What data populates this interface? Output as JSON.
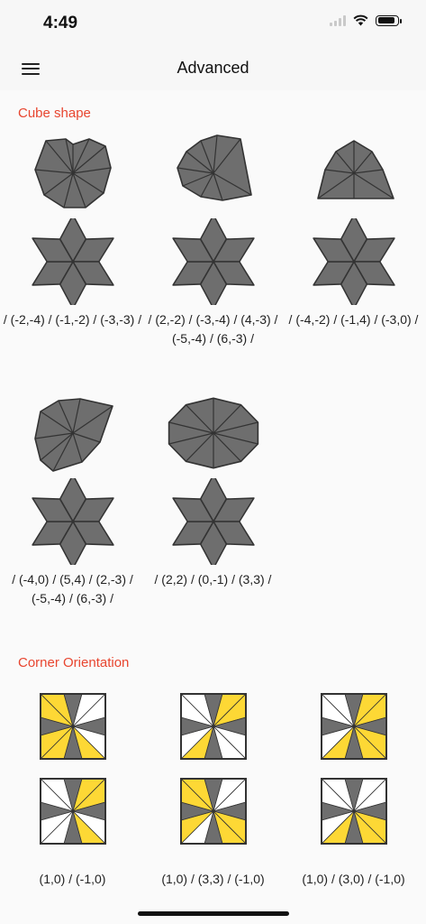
{
  "status": {
    "time": "4:49",
    "icons": [
      "signal-icon",
      "wifi-icon",
      "battery-icon"
    ]
  },
  "nav": {
    "title": "Advanced",
    "menu_icon": "hamburger-menu-icon"
  },
  "sections": {
    "cube_shape": {
      "title": "Cube shape",
      "cases": [
        {
          "alg": "/ (-2,-4) / (-1,-2) / (-3,-3) /",
          "top_shape": "shape-a"
        },
        {
          "alg": "/ (2,-2) / (-3,-4) / (4,-3) / (-5,-4) / (6,-3) /",
          "top_shape": "shape-b"
        },
        {
          "alg": "/ (-4,-2) / (-1,4) / (-3,0) /",
          "top_shape": "shape-c"
        },
        {
          "alg": "/ (-4,0) / (5,4) / (2,-3) / (-5,-4) / (6,-3) /",
          "top_shape": "shape-d"
        },
        {
          "alg": "/ (2,2) / (0,-1) / (3,3) /",
          "top_shape": "shape-e"
        }
      ]
    },
    "corner_orientation": {
      "title": "Corner Orientation",
      "cases": [
        {
          "alg": "(1,0) / (-1,0)"
        },
        {
          "alg": "(1,0) / (3,3) / (-1,0)"
        },
        {
          "alg": "(1,0) / (3,0) / (-1,0)"
        }
      ]
    }
  },
  "colors": {
    "accent": "#e8452f",
    "piece_gray": "#6e6e6e",
    "piece_yellow": "#fdd835",
    "piece_white": "#ffffff",
    "outline": "#333333"
  }
}
